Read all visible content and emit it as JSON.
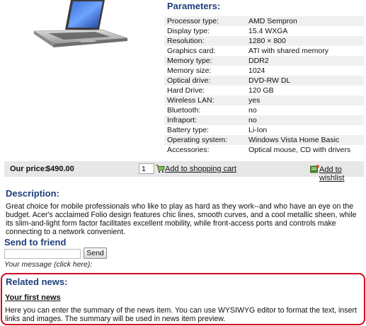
{
  "product": {
    "image_icon": "laptop-image",
    "params_title": "Parameters:",
    "params": [
      {
        "label": "Processor type:",
        "value": "AMD Sempron"
      },
      {
        "label": "Display type:",
        "value": "15.4 WXGA"
      },
      {
        "label": "Resolution:",
        "value": "1280 × 800"
      },
      {
        "label": "Graphics card:",
        "value": "ATI with shared memory"
      },
      {
        "label": "Memory type:",
        "value": "DDR2"
      },
      {
        "label": "Memory size:",
        "value": "1024"
      },
      {
        "label": "Optical drive:",
        "value": "DVD-RW DL"
      },
      {
        "label": "Hard Drive:",
        "value": "120 GB"
      },
      {
        "label": "Wireless LAN:",
        "value": "yes"
      },
      {
        "label": "Bluetooth:",
        "value": "no"
      },
      {
        "label": "Infraport:",
        "value": "no"
      },
      {
        "label": "Battery type:",
        "value": "Li-Ion"
      },
      {
        "label": "Operating system:",
        "value": "Windows Vista Home Basic"
      },
      {
        "label": "Accessories:",
        "value": "Optical mouse, CD with drivers"
      }
    ]
  },
  "purchase": {
    "price_label": "Our price:",
    "price_value": "$490.00",
    "quantity": "1",
    "cart_icon": "shopping-cart-icon",
    "add_to_cart": "Add to shopping cart",
    "wishlist_icon": "wishlist-icon",
    "add_to_wishlist": "Add to wishlist"
  },
  "description": {
    "title": "Description:",
    "text": "Great choice for mobile professionals who like to play as hard as they work--and who have an eye on the budget. Acer's acclaimed Folio design features chic lines, smooth curves, and a cool metallic sheen, while its slim-and-light form factor facilitates excellent mobility, while front-access ports and controls make connecting to a network convenient."
  },
  "send_to_friend": {
    "title": "Send to friend",
    "input_value": "",
    "button_label": "Send",
    "message_link": "Your message (click here):"
  },
  "related_news": {
    "title": "Related news:",
    "items": [
      {
        "title": "Your first news",
        "summary": "Here you can enter the summary of the news item. You can use WYSIWYG editor to format the text, insert links and images. The summary will be used in news item preview."
      }
    ]
  },
  "colors": {
    "heading": "#1d3f7a",
    "highlight_border": "#d10a1f",
    "price_bar": "#e7e7e7"
  }
}
